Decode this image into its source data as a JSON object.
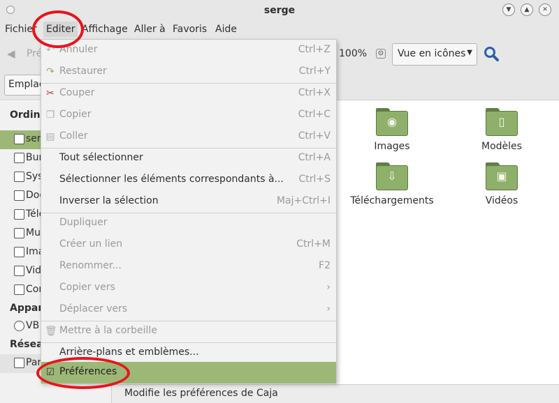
{
  "window": {
    "title": "serge"
  },
  "menubar": {
    "items": [
      "Fichier",
      "Editer",
      "Affichage",
      "Aller à",
      "Favoris",
      "Aide"
    ]
  },
  "toolbar": {
    "back_label": "Pré",
    "zoom": "100%",
    "view_mode": "Vue en icônes"
  },
  "pathbar": {
    "location_label": "Emplac"
  },
  "sidebar": {
    "sections": [
      "Ordina",
      "Appare",
      "Réseau"
    ],
    "items": [
      {
        "label": "ser",
        "icon": "home-folder-icon",
        "selected": true
      },
      {
        "label": "Bur",
        "icon": "desktop-folder-icon"
      },
      {
        "label": "Sys",
        "icon": "filesystem-icon"
      },
      {
        "label": "Doc",
        "icon": "documents-folder-icon"
      },
      {
        "label": "Télé",
        "icon": "downloads-folder-icon"
      },
      {
        "label": "Mu",
        "icon": "music-folder-icon"
      },
      {
        "label": "Ima",
        "icon": "pictures-folder-icon"
      },
      {
        "label": "Vid",
        "icon": "videos-folder-icon"
      },
      {
        "label": "Cor",
        "icon": "trash-icon"
      },
      {
        "label": "VB",
        "icon": "optical-drive-icon"
      },
      {
        "label": "Par",
        "icon": "network-icon"
      }
    ]
  },
  "files": [
    {
      "label": "Images",
      "icon": "pictures-folder-icon",
      "glyph": "◉"
    },
    {
      "label": "Modèles",
      "icon": "templates-folder-icon",
      "glyph": "▯"
    },
    {
      "label": "Téléchargements",
      "icon": "downloads-folder-icon",
      "glyph": "⇩"
    },
    {
      "label": "Vidéos",
      "icon": "videos-folder-icon",
      "glyph": "▣"
    }
  ],
  "edit_menu": {
    "items": [
      {
        "label": "Annuler",
        "accel": "Ctrl+Z",
        "disabled": true,
        "icon": "↶"
      },
      {
        "label": "Restaurer",
        "accel": "Ctrl+Y",
        "disabled": true,
        "icon": "↷"
      },
      {
        "label": "Couper",
        "accel": "Ctrl+X",
        "disabled": true,
        "icon": "✂"
      },
      {
        "label": "Copier",
        "accel": "Ctrl+C",
        "disabled": true,
        "icon": "❐"
      },
      {
        "label": "Coller",
        "accel": "Ctrl+V",
        "disabled": true,
        "icon": "▤"
      },
      {
        "label": "Tout sélectionner",
        "accel": "Ctrl+A",
        "disabled": false,
        "icon": ""
      },
      {
        "label": "Sélectionner les éléments correspondants à...",
        "accel": "Ctrl+S",
        "disabled": false,
        "icon": ""
      },
      {
        "label": "Inverser la sélection",
        "accel": "Maj+Ctrl+I",
        "disabled": false,
        "icon": ""
      },
      {
        "label": "Dupliquer",
        "accel": "",
        "disabled": true,
        "icon": ""
      },
      {
        "label": "Créer un lien",
        "accel": "Ctrl+M",
        "disabled": true,
        "icon": ""
      },
      {
        "label": "Renommer...",
        "accel": "F2",
        "disabled": true,
        "icon": ""
      },
      {
        "label": "Copier vers",
        "accel": "›",
        "disabled": true,
        "icon": ""
      },
      {
        "label": "Déplacer vers",
        "accel": "›",
        "disabled": true,
        "icon": ""
      },
      {
        "label": "Mettre à la corbeille",
        "accel": "",
        "disabled": true,
        "icon": "🗑"
      },
      {
        "label": "Arrière-plans et emblèmes...",
        "accel": "",
        "disabled": false,
        "icon": ""
      },
      {
        "label": "Préférences",
        "accel": "",
        "disabled": false,
        "highlighted": true,
        "icon": "☑"
      }
    ]
  },
  "statusbar": {
    "text": "Modifie les préférences de Caja"
  },
  "colors": {
    "accent": "#9db876",
    "annotation": "#e8141c"
  }
}
